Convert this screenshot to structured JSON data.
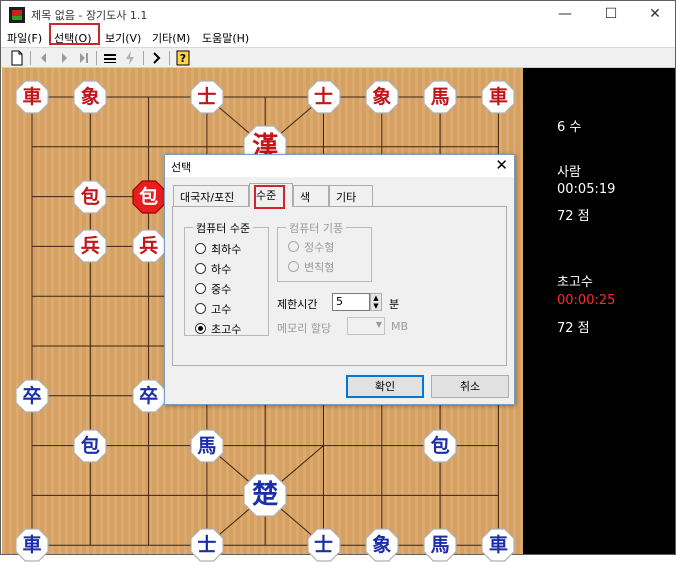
{
  "window": {
    "title": "제목 없음 - 장기도사 1.1",
    "minimize": "—",
    "maximize": "☐",
    "close": "✕"
  },
  "menu": [
    "파일(F)",
    "선택(O)",
    "보기(V)",
    "기타(M)",
    "도움말(H)"
  ],
  "toolbar": {
    "icons": [
      "new-file-icon",
      "first-move-icon",
      "prev-move-icon",
      "next-move-icon",
      "last-move-icon",
      "board-icon",
      "disabled-icon",
      "step-icon",
      "hint-icon"
    ]
  },
  "board": {
    "colors": {
      "wood": "#dba566",
      "red": "#c3141a",
      "blue": "#1c2ea8"
    },
    "pieces": [
      {
        "glyph": "車",
        "color": "red",
        "col": 0,
        "row": 0,
        "name": "red-chariot"
      },
      {
        "glyph": "象",
        "color": "red",
        "col": 1,
        "row": 0,
        "name": "red-elephant"
      },
      {
        "glyph": "士",
        "color": "red",
        "col": 3,
        "row": 0,
        "name": "red-guard"
      },
      {
        "glyph": "士",
        "color": "red",
        "col": 5,
        "row": 0,
        "name": "red-guard"
      },
      {
        "glyph": "象",
        "color": "red",
        "col": 6,
        "row": 0,
        "name": "red-elephant"
      },
      {
        "glyph": "馬",
        "color": "red",
        "col": 7,
        "row": 0,
        "name": "red-horse"
      },
      {
        "glyph": "車",
        "color": "red",
        "col": 8,
        "row": 0,
        "name": "red-chariot"
      },
      {
        "glyph": "漢",
        "color": "red",
        "col": 4,
        "row": 1,
        "name": "red-general",
        "big": true
      },
      {
        "glyph": "包",
        "color": "red",
        "col": 1,
        "row": 2,
        "name": "red-cannon"
      },
      {
        "glyph": "包",
        "color": "red",
        "col": 2,
        "row": 2,
        "name": "red-cannon",
        "sel": true
      },
      {
        "glyph": "兵",
        "color": "red",
        "col": 1,
        "row": 3,
        "name": "red-soldier"
      },
      {
        "glyph": "兵",
        "color": "red",
        "col": 2,
        "row": 3,
        "name": "red-soldier"
      },
      {
        "glyph": "卒",
        "color": "blue",
        "col": 0,
        "row": 6,
        "name": "blue-soldier"
      },
      {
        "glyph": "卒",
        "color": "blue",
        "col": 2,
        "row": 6,
        "name": "blue-soldier"
      },
      {
        "glyph": "包",
        "color": "blue",
        "col": 1,
        "row": 7,
        "name": "blue-cannon"
      },
      {
        "glyph": "馬",
        "color": "blue",
        "col": 3,
        "row": 7,
        "name": "blue-horse"
      },
      {
        "glyph": "包",
        "color": "blue",
        "col": 7,
        "row": 7,
        "name": "blue-cannon"
      },
      {
        "glyph": "楚",
        "color": "blue",
        "col": 4,
        "row": 8,
        "name": "blue-general",
        "big": true
      },
      {
        "glyph": "車",
        "color": "blue",
        "col": 0,
        "row": 9,
        "name": "blue-chariot"
      },
      {
        "glyph": "士",
        "color": "blue",
        "col": 3,
        "row": 9,
        "name": "blue-guard"
      },
      {
        "glyph": "士",
        "color": "blue",
        "col": 5,
        "row": 9,
        "name": "blue-guard"
      },
      {
        "glyph": "象",
        "color": "blue",
        "col": 6,
        "row": 9,
        "name": "blue-elephant"
      },
      {
        "glyph": "馬",
        "color": "blue",
        "col": 7,
        "row": 9,
        "name": "blue-horse"
      },
      {
        "glyph": "車",
        "color": "blue",
        "col": 8,
        "row": 9,
        "name": "blue-chariot"
      }
    ]
  },
  "info": {
    "move_count": "6 수",
    "player1_name": "사람",
    "player1_time": "00:05:19",
    "player1_score": "72 점",
    "player2_name": "초고수",
    "player2_time": "00:00:25",
    "player2_score": "72 점",
    "active_time_color": "#ff2a2a"
  },
  "dialog": {
    "title": "선택",
    "close": "✕",
    "tabs": [
      "대국자/포진",
      "수준",
      "색",
      "기타"
    ],
    "active_tab": 1,
    "level_group": "컴퓨터 수준",
    "levels": [
      "최하수",
      "하수",
      "중수",
      "고수",
      "초고수"
    ],
    "selected_level": 4,
    "style_group": "컴퓨터 기풍",
    "styles": [
      "정수형",
      "변칙형"
    ],
    "time_limit_label": "제한시간",
    "time_limit_value": "5",
    "time_limit_unit": "분",
    "memory_label": "메모리 할당",
    "memory_unit": "MB",
    "ok": "확인",
    "cancel": "취소"
  }
}
